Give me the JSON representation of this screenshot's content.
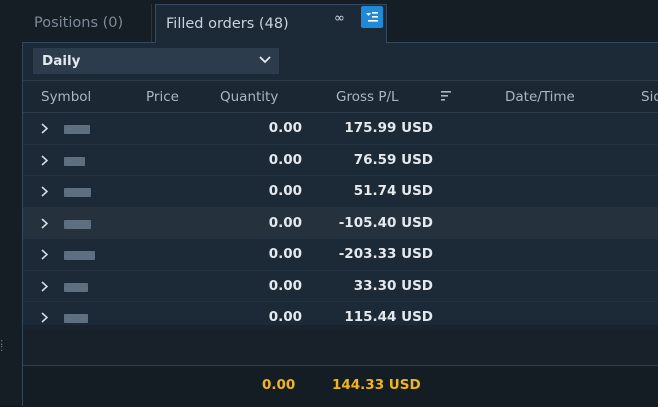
{
  "tabs": {
    "positions_label": "Positions (0)",
    "filled_label": "Filled orders (48)",
    "link_icon": "∞"
  },
  "filter": {
    "period": "Daily"
  },
  "columns": {
    "symbol": "Symbol",
    "price": "Price",
    "quantity": "Quantity",
    "gross_pl": "Gross P/L",
    "datetime": "Date/Time",
    "side": "Side"
  },
  "rows": [
    {
      "quantity": "0.00",
      "gross_pl": "175.99 USD"
    },
    {
      "quantity": "0.00",
      "gross_pl": "76.59 USD"
    },
    {
      "quantity": "0.00",
      "gross_pl": "51.74 USD"
    },
    {
      "quantity": "0.00",
      "gross_pl": "-105.40 USD"
    },
    {
      "quantity": "0.00",
      "gross_pl": "-203.33 USD"
    },
    {
      "quantity": "0.00",
      "gross_pl": "33.30 USD"
    },
    {
      "quantity": "0.00",
      "gross_pl": "115.44 USD"
    }
  ],
  "totals": {
    "quantity": "0.00",
    "gross_pl": "144.33 USD"
  },
  "colors": {
    "accent": "#1f8ad6",
    "total_text": "#f0b51c",
    "panel_bg": "#1c2937"
  }
}
